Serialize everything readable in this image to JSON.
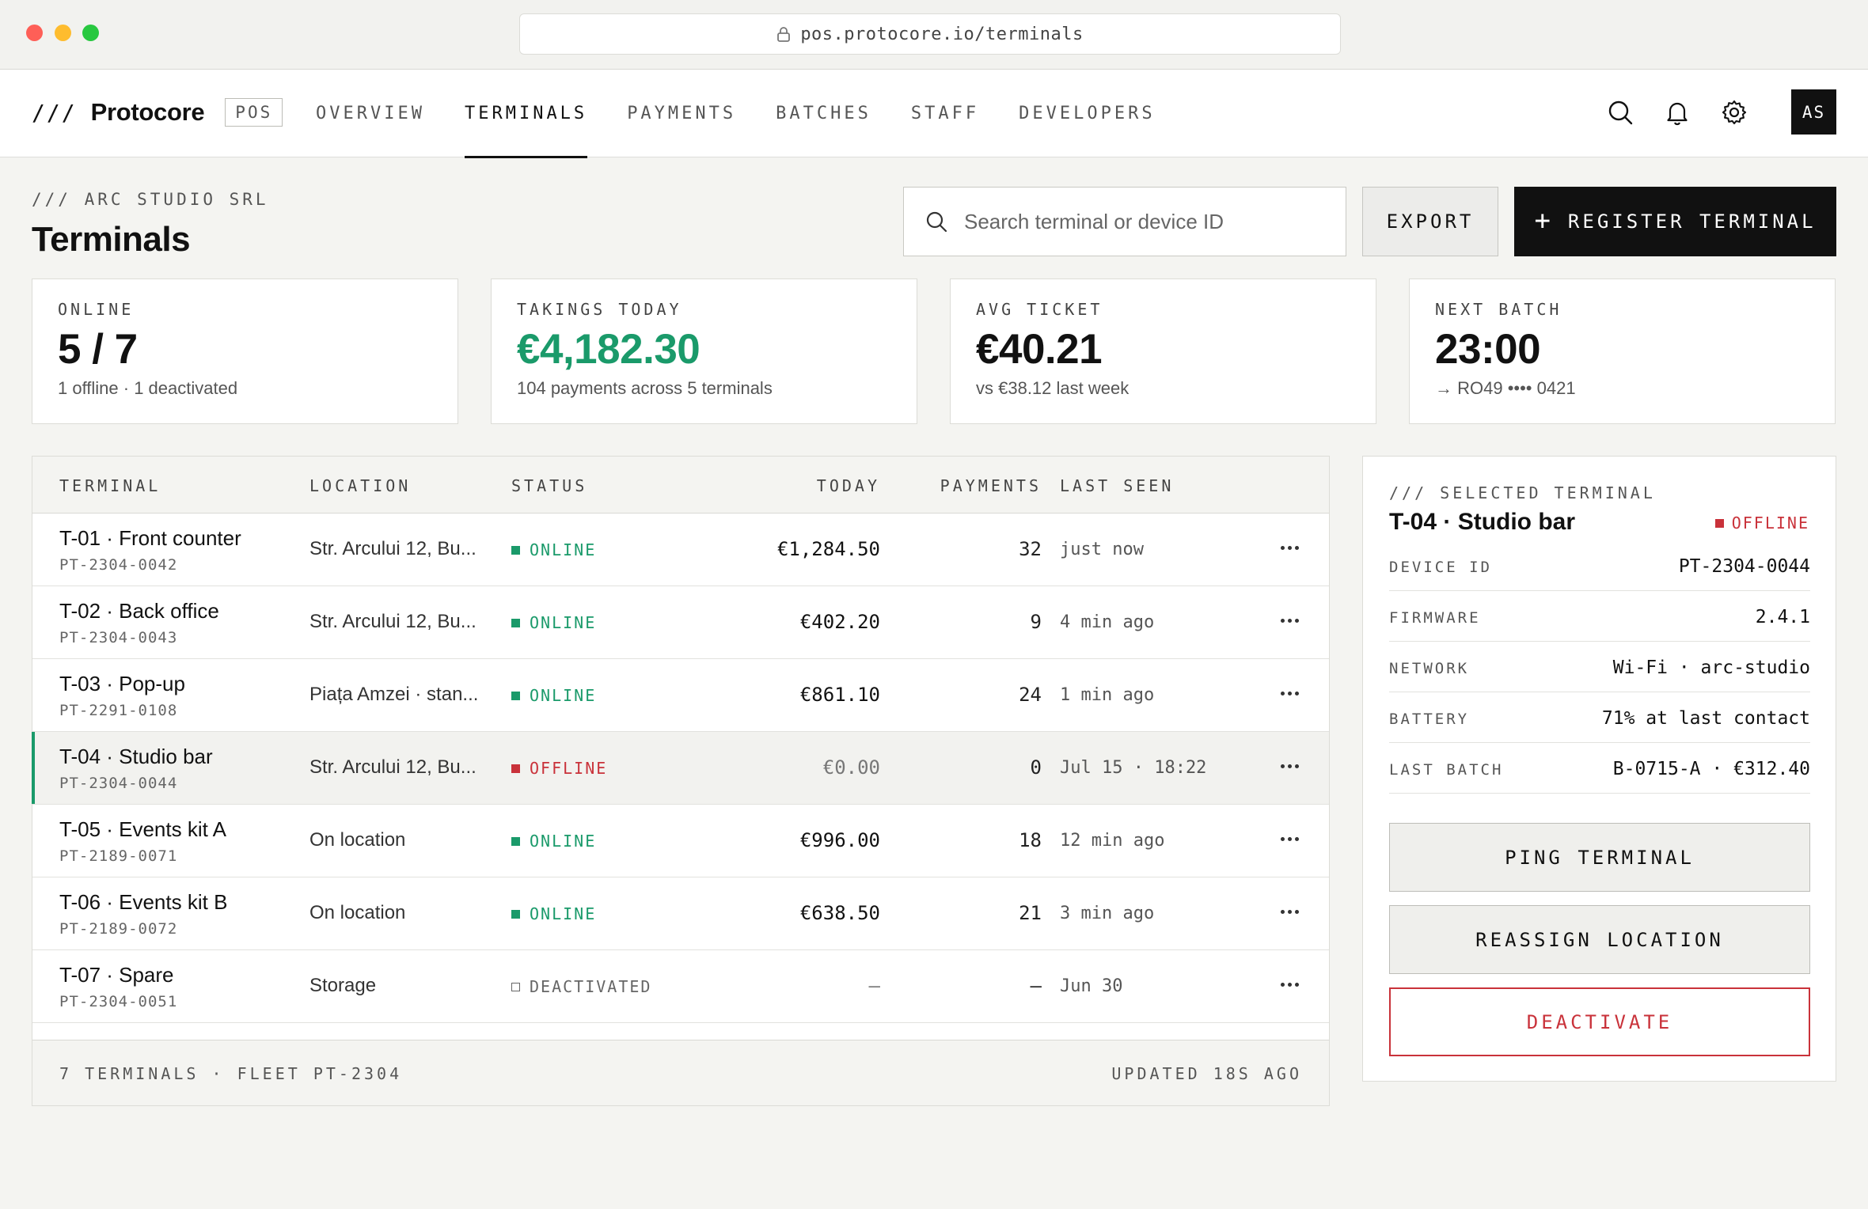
{
  "browser": {
    "url": "pos.protocore.io/terminals"
  },
  "brand": {
    "slashes": "///",
    "name": "Protocore",
    "tag": "POS"
  },
  "nav": {
    "links": [
      "OVERVIEW",
      "TERMINALS",
      "PAYMENTS",
      "BATCHES",
      "STAFF",
      "DEVELOPERS"
    ],
    "active": "TERMINALS",
    "avatar": "AS"
  },
  "header": {
    "org": "/// ARC STUDIO SRL",
    "title": "Terminals",
    "search_placeholder": "Search terminal or device ID",
    "export_label": "EXPORT",
    "register_label": "REGISTER TERMINAL",
    "register_icon": "+"
  },
  "stats": [
    {
      "label": "ONLINE",
      "value": "5 / 7",
      "sub": "1 offline · 1 deactivated"
    },
    {
      "label": "TAKINGS TODAY",
      "value": "€4,182.30",
      "sub": "104 payments across 5 terminals"
    },
    {
      "label": "AVG TICKET",
      "value": "€40.21",
      "sub": "vs €38.12 last week"
    },
    {
      "label": "NEXT BATCH",
      "value": "23:00",
      "sub": "→ RO49 •••• 0421"
    }
  ],
  "table": {
    "headers": {
      "terminal": "TERMINAL",
      "location": "LOCATION",
      "status": "STATUS",
      "today": "TODAY",
      "payments": "PAYMENTS",
      "last_seen": "LAST SEEN"
    },
    "rows": [
      {
        "name": "T-01 · Front counter",
        "id": "PT-2304-0042",
        "location": "Str. Arcului 12, Bu...",
        "status": "ONLINE",
        "today": "€1,284.50",
        "payments": "32",
        "last_seen": "just now"
      },
      {
        "name": "T-02 · Back office",
        "id": "PT-2304-0043",
        "location": "Str. Arcului 12, Bu...",
        "status": "ONLINE",
        "today": "€402.20",
        "payments": "9",
        "last_seen": "4 min ago"
      },
      {
        "name": "T-03 · Pop-up",
        "id": "PT-2291-0108",
        "location": "Piața Amzei · stan...",
        "status": "ONLINE",
        "today": "€861.10",
        "payments": "24",
        "last_seen": "1 min ago"
      },
      {
        "name": "T-04 · Studio bar",
        "id": "PT-2304-0044",
        "location": "Str. Arcului 12, Bu...",
        "status": "OFFLINE",
        "today": "€0.00",
        "payments": "0",
        "last_seen": "Jul 15 · 18:22"
      },
      {
        "name": "T-05 · Events kit A",
        "id": "PT-2189-0071",
        "location": "On location",
        "status": "ONLINE",
        "today": "€996.00",
        "payments": "18",
        "last_seen": "12 min ago"
      },
      {
        "name": "T-06 · Events kit B",
        "id": "PT-2189-0072",
        "location": "On location",
        "status": "ONLINE",
        "today": "€638.50",
        "payments": "21",
        "last_seen": "3 min ago"
      },
      {
        "name": "T-07 · Spare",
        "id": "PT-2304-0051",
        "location": "Storage",
        "status": "DEACTIVATED",
        "today": "—",
        "payments": "—",
        "last_seen": "Jun 30"
      }
    ],
    "footer_left": "7 TERMINALS · FLEET PT-2304",
    "footer_right": "UPDATED 18S AGO"
  },
  "panel": {
    "tag": "/// SELECTED TERMINAL",
    "title": "T-04 · Studio bar",
    "status": "OFFLINE",
    "details": [
      {
        "key": "DEVICE ID",
        "value": "PT-2304-0044"
      },
      {
        "key": "FIRMWARE",
        "value": "2.4.1"
      },
      {
        "key": "NETWORK",
        "value": "Wi-Fi · arc-studio"
      },
      {
        "key": "BATTERY",
        "value": "71% at last contact"
      },
      {
        "key": "LAST BATCH",
        "value": "B-0715-A · €312.40"
      }
    ],
    "ping_label": "PING TERMINAL",
    "reassign_label": "REASSIGN LOCATION",
    "deactivate_label": "DEACTIVATE"
  },
  "colors": {
    "online": "#1a9a6a",
    "offline": "#c9323a",
    "ink": "#111111"
  },
  "icons": [
    "lock-icon",
    "search-icon",
    "bell-icon",
    "gear-icon",
    "more-icon"
  ]
}
